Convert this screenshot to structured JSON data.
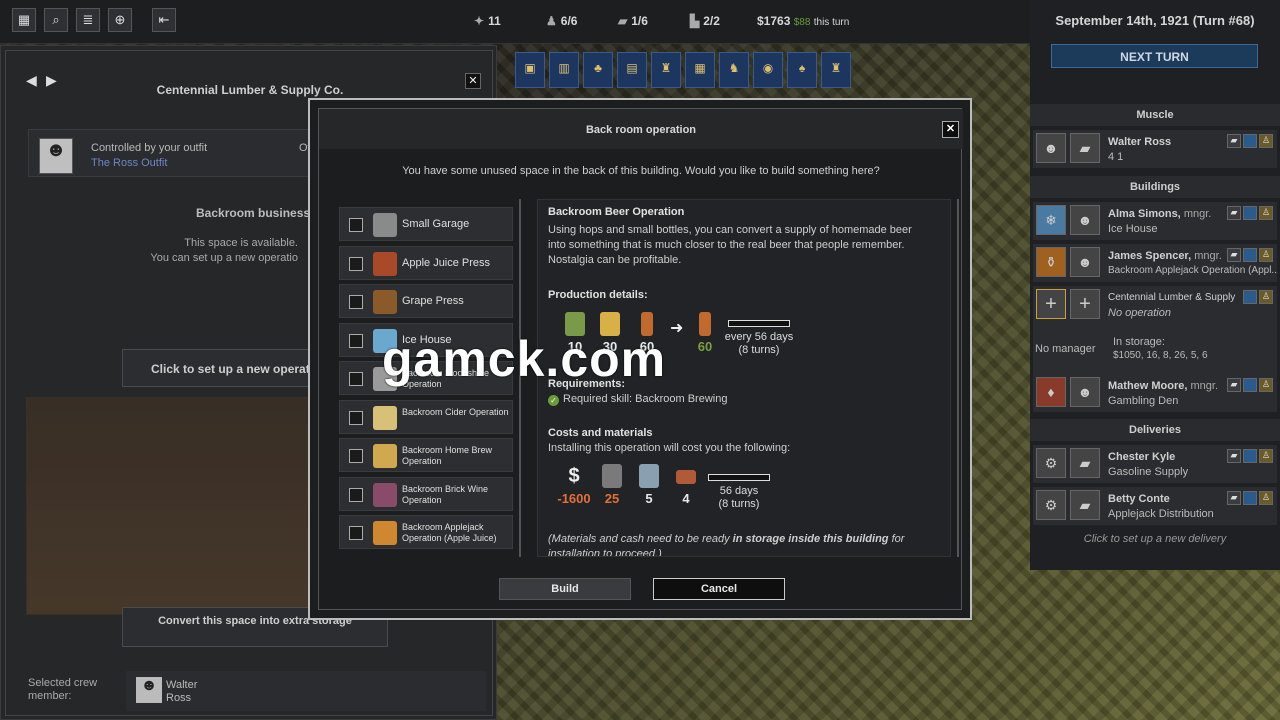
{
  "topbar": {
    "stats": {
      "actions": "11",
      "crew": "6/6",
      "vehicles": "1/6",
      "buildings": "2/2",
      "cash": "$1763",
      "income": "$88",
      "income_suffix": "this turn"
    }
  },
  "right": {
    "date": "September 14th, 1921 (Turn #68)",
    "next_turn": "NEXT TURN",
    "muscle_title": "Muscle",
    "walter": {
      "name": "Walter Ross",
      "stats": "4  1"
    },
    "buildings_title": "Buildings",
    "alma": {
      "name": "Alma Simons,",
      "role": "mngr.",
      "sub": "Ice House"
    },
    "james": {
      "name": "James Spencer,",
      "role": "mngr.",
      "sub": "Backroom Applejack Operation (Appl..."
    },
    "centennial": {
      "name": "Centennial Lumber & Supply",
      "sub": "No operation"
    },
    "no_manager": "No manager",
    "storage_label": "In storage:",
    "storage_value": "$1050, 16, 8, 26, 5, 6",
    "mathew": {
      "name": "Mathew Moore,",
      "role": "mngr.",
      "sub": "Gambling Den"
    },
    "deliveries_title": "Deliveries",
    "chester": {
      "name": "Chester Kyle",
      "sub": "Gasoline Supply"
    },
    "betty": {
      "name": "Betty Conte",
      "sub": "Applejack Distribution"
    },
    "new_delivery": "Click to set up a new delivery"
  },
  "left": {
    "title": "Centennial Lumber & Supply Co.",
    "controlled": "Controlled by your outfit",
    "outfit": "The Ross Outfit",
    "owner_trunc": "Ov",
    "subtitle": "Backroom business",
    "avail1": "This space is available.",
    "avail2": "You can set up a new operatio",
    "setup_btn": "Click to set up a new operation h",
    "convert_btn": "Convert this space into extra storage",
    "crew_label": "Selected crew member:",
    "crew_name": "Walter Ross"
  },
  "modal": {
    "title": "Back room operation",
    "question": "You have some unused space in the back of this building. Would you like to build something here?",
    "options": [
      {
        "label": "Small Garage",
        "color": "#8a8a8a"
      },
      {
        "label": "Apple Juice Press",
        "color": "#a84a2a"
      },
      {
        "label": "Grape Press",
        "color": "#8a5a2a"
      },
      {
        "label": "Ice House",
        "color": "#6aa8d0"
      },
      {
        "label": "Backroom Moonshine Operation",
        "color": "#9a9a9a"
      },
      {
        "label": "Backroom Cider Operation",
        "color": "#d8c078"
      },
      {
        "label": "Backroom Home Brew Operation",
        "color": "#d0a850"
      },
      {
        "label": "Backroom Brick Wine Operation",
        "color": "#8a4a6a"
      },
      {
        "label": "Backroom Applejack Operation (Apple Juice)",
        "color": "#d08830"
      }
    ],
    "detail": {
      "name": "Backroom Beer Operation",
      "desc": "Using hops and small bottles, you can convert a supply of homemade beer into something that is much closer to the real beer that people remember. Nostalgia can be profitable.",
      "prod_title": "Production details:",
      "inputs": [
        {
          "qty": "10",
          "color": "#7a9a4a"
        },
        {
          "qty": "30",
          "color": "#d8b048"
        },
        {
          "qty": "60",
          "color": "#c06a30"
        }
      ],
      "output": {
        "qty": "60",
        "color": "#c06a30"
      },
      "prod_days": "every 56 days",
      "prod_turns": "(8 turns)",
      "req_title": "Requirements:",
      "req_skill": "Required skill: Backroom Brewing",
      "cost_title": "Costs and materials",
      "cost_desc": "Installing this operation will cost you the following:",
      "costs": [
        {
          "qty": "-1600",
          "icon": "$"
        },
        {
          "qty": "25",
          "color": "#7a7a7a"
        },
        {
          "qty": "5",
          "color": "#8aa0b0"
        },
        {
          "qty": "4",
          "color": "#b05a3a"
        }
      ],
      "cost_days": "56 days",
      "cost_turns": "(8 turns)",
      "note_a": "(Materials and cash need to be ready ",
      "note_b": "in storage inside this building",
      "note_c": " for installation to proceed.)"
    },
    "build": "Build",
    "cancel": "Cancel"
  },
  "watermark": "gamck.com",
  "colors": {
    "accent_blue": "#1c3a5a",
    "neg": "#e0703a",
    "pos": "#7aa040"
  }
}
